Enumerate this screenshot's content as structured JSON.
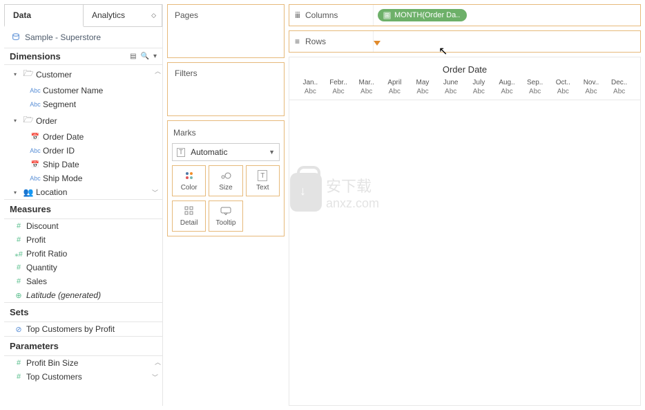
{
  "tabs": {
    "data": "Data",
    "analytics": "Analytics"
  },
  "datasource": "Sample - Superstore",
  "sections": {
    "dimensions": "Dimensions",
    "measures": "Measures",
    "sets": "Sets",
    "parameters": "Parameters"
  },
  "dims": {
    "customer": "Customer",
    "customer_name": "Customer Name",
    "segment": "Segment",
    "order": "Order",
    "order_date": "Order Date",
    "order_id": "Order ID",
    "ship_date": "Ship Date",
    "ship_mode": "Ship Mode",
    "location": "Location"
  },
  "meas": {
    "discount": "Discount",
    "profit": "Profit",
    "profit_ratio": "Profit Ratio",
    "quantity": "Quantity",
    "sales": "Sales",
    "latitude": "Latitude (generated)"
  },
  "sets": {
    "top_customers": "Top Customers by Profit"
  },
  "params": {
    "profit_bin": "Profit Bin Size",
    "top_customers": "Top Customers"
  },
  "shelves": {
    "pages": "Pages",
    "filters": "Filters",
    "marks": "Marks",
    "columns": "Columns",
    "rows": "Rows"
  },
  "marks": {
    "select": "Automatic",
    "color": "Color",
    "size": "Size",
    "text": "Text",
    "detail": "Detail",
    "tooltip": "Tooltip"
  },
  "pill": "MONTH(Order Da..",
  "viz": {
    "title": "Order Date",
    "months": [
      "Jan..",
      "Febr..",
      "Mar..",
      "April",
      "May",
      "June",
      "July",
      "Aug..",
      "Sep..",
      "Oct..",
      "Nov..",
      "Dec.."
    ],
    "abc": "Abc"
  },
  "watermark": {
    "zh": "安下载",
    "en": "anxz.com"
  }
}
